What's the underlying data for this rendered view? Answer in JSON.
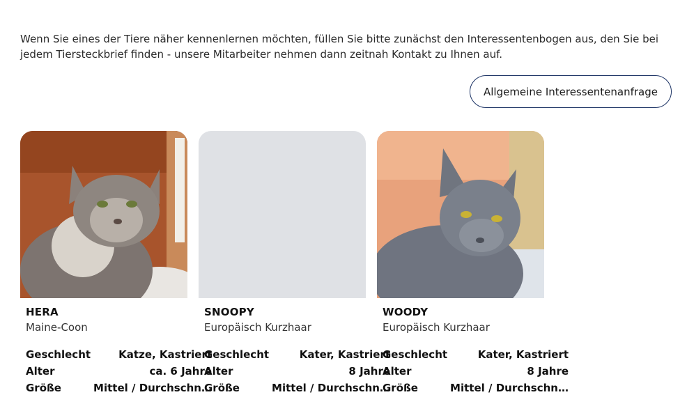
{
  "intro_text": "Wenn Sie eines der Tiere näher kennenlernen möchten, füllen Sie bitte zunächst den Interessentenbogen aus, den Sie bei jedem Tiersteckbrief finden - unsere Mitarbeiter nehmen dann zeitnah Kontakt zu Ihnen auf.",
  "general_inquiry_button": "Allgemeine Interessentenanfrage",
  "labels": {
    "gender": "Geschlecht",
    "age": "Alter",
    "size": "Größe"
  },
  "animals": [
    {
      "name": "HERA",
      "breed": "Maine-Coon",
      "gender": "Katze, Kastriert",
      "age": "ca. 6 Jahre",
      "size": "Mittel / Durchschnitt"
    },
    {
      "name": "SNOOPY",
      "breed": "Europäisch Kurzhaar",
      "gender": "Kater, Kastriert",
      "age": "8 Jahre",
      "size": "Mittel / Durchschnitt"
    },
    {
      "name": "WOODY",
      "breed": "Europäisch Kurzhaar",
      "gender": "Kater, Kastriert",
      "age": "8 Jahre",
      "size": "Mittel / Durchschnitt"
    }
  ],
  "colors": {
    "button_border": "#1e3566",
    "placeholder_bg": "#dfe1e5"
  }
}
